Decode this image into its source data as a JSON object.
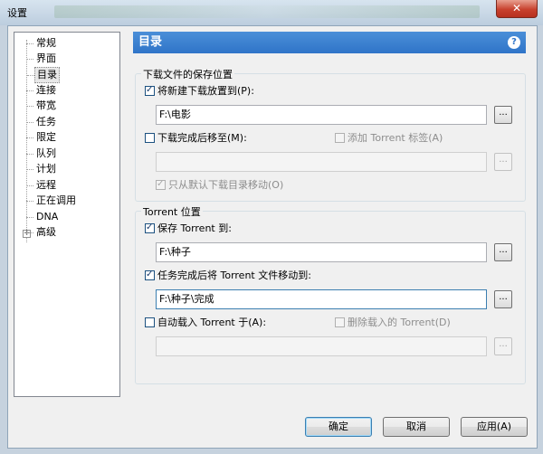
{
  "window": {
    "title": "设置",
    "close_label": "✕"
  },
  "tree": {
    "items": [
      {
        "label": "常规"
      },
      {
        "label": "界面"
      },
      {
        "label": "目录"
      },
      {
        "label": "连接"
      },
      {
        "label": "带宽"
      },
      {
        "label": "任务"
      },
      {
        "label": "限定"
      },
      {
        "label": "队列"
      },
      {
        "label": "计划"
      },
      {
        "label": "远程"
      },
      {
        "label": "正在调用"
      },
      {
        "label": "DNA"
      },
      {
        "label": "高级"
      }
    ],
    "expander": "+",
    "selected": "目录"
  },
  "panel": {
    "title": "目录",
    "help_icon": "?"
  },
  "download_group": {
    "label": "下载文件的保存位置",
    "put_new_label": "将新建下载放置到(P):",
    "put_new_checked": true,
    "put_new_path": "F:\\电影",
    "move_completed_label": "下载完成后移至(M):",
    "move_completed_checked": false,
    "add_tag_label": "添加 Torrent 标签(A)",
    "add_tag_checked": false,
    "move_completed_path": "",
    "only_default_label": "只从默认下载目录移动(O)",
    "only_default_checked": true
  },
  "torrent_group": {
    "label": "Torrent 位置",
    "save_label": "保存 Torrent 到:",
    "save_checked": true,
    "save_path": "F:\\种子",
    "move_done_label": "任务完成后将 Torrent 文件移动到:",
    "move_done_checked": true,
    "move_done_path": "F:\\种子\\完成",
    "autoload_label": "自动载入 Torrent 于(A):",
    "autoload_checked": false,
    "delete_loaded_label": "删除载入的 Torrent(D)",
    "delete_loaded_checked": false,
    "autoload_path": ""
  },
  "browse_label": "...",
  "buttons": {
    "ok": "确定",
    "cancel": "取消",
    "apply": "应用(A)"
  },
  "colors": {
    "header_blue": "#2f74c8",
    "close_red": "#c8412e"
  }
}
